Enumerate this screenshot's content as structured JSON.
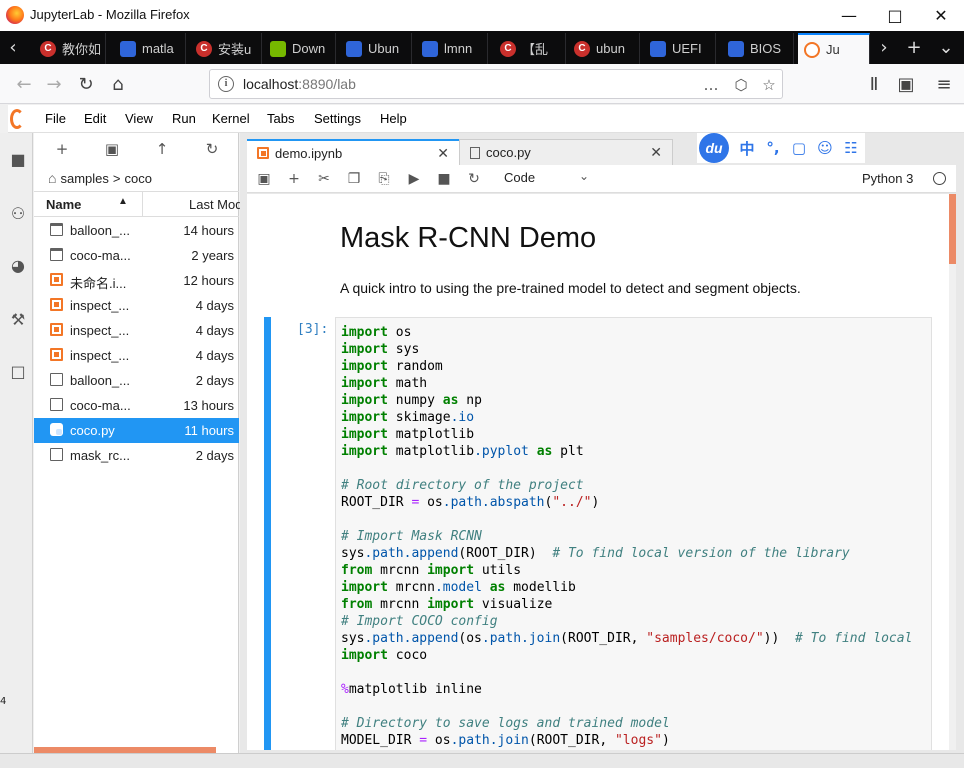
{
  "window": {
    "title": "JupyterLab - Mozilla Firefox"
  },
  "browser_tabs": [
    {
      "label": "教你如",
      "favicon": "csdn"
    },
    {
      "label": "matla",
      "favicon": "baidu"
    },
    {
      "label": "安装u",
      "favicon": "csdn"
    },
    {
      "label": "Down",
      "favicon": "nvidia"
    },
    {
      "label": "Ubun",
      "favicon": "baidu"
    },
    {
      "label": "lmnn",
      "favicon": "baidu"
    },
    {
      "label": "【乱",
      "favicon": "csdn"
    },
    {
      "label": "ubun",
      "favicon": "csdn"
    },
    {
      "label": "UEFI",
      "favicon": "baidu"
    },
    {
      "label": "BIOS",
      "favicon": "baidu"
    },
    {
      "label": "Ju",
      "favicon": "jupyter",
      "active": true
    }
  ],
  "navbar": {
    "url_host": "localhost",
    "url_path": ":8890/lab"
  },
  "jupyter_menu": [
    "File",
    "Edit",
    "View",
    "Run",
    "Kernel",
    "Tabs",
    "Settings",
    "Help"
  ],
  "filebrowser": {
    "breadcrumb": [
      "samples",
      "coco"
    ],
    "breadcrumb_separator": ">",
    "header": {
      "name": "Name",
      "modified": "Last Modified"
    },
    "files": [
      {
        "name": "balloon_...",
        "modified": "14 hours",
        "type": "folder"
      },
      {
        "name": "coco-ma...",
        "modified": "2 years",
        "type": "folder"
      },
      {
        "name": "未命名.i...",
        "modified": "12 hours",
        "type": "notebook"
      },
      {
        "name": "inspect_...",
        "modified": "4 days",
        "type": "notebook"
      },
      {
        "name": "inspect_...",
        "modified": "4 days",
        "type": "notebook"
      },
      {
        "name": "inspect_...",
        "modified": "4 days",
        "type": "notebook"
      },
      {
        "name": "balloon_...",
        "modified": "2 days",
        "type": "file"
      },
      {
        "name": "coco-ma...",
        "modified": "13 hours",
        "type": "file"
      },
      {
        "name": "coco.py",
        "modified": "11 hours",
        "type": "python",
        "selected": true
      },
      {
        "name": "mask_rc...",
        "modified": "2 days",
        "type": "file"
      }
    ]
  },
  "doc_tabs": [
    {
      "label": "demo.ipynb",
      "active": true
    },
    {
      "label": "coco.py",
      "active": false
    }
  ],
  "ime": {
    "logo": "du",
    "lang": "中",
    "punct": "°,",
    "icons": [
      "keyboard-icon",
      "user-icon",
      "grid-icon"
    ]
  },
  "notebook_toolbar": {
    "cell_type": "Code",
    "kernel": "Python 3"
  },
  "notebook": {
    "heading": "Mask R-CNN Demo",
    "intro": "A quick intro to using the pre-trained model to detect and segment objects.",
    "cell_prompt": "[3]:"
  },
  "colors": {
    "accent": "#2196f3",
    "jupyter_orange": "#f37626",
    "scroll_thumb": "#ec8a66"
  },
  "edge_marker": "4"
}
